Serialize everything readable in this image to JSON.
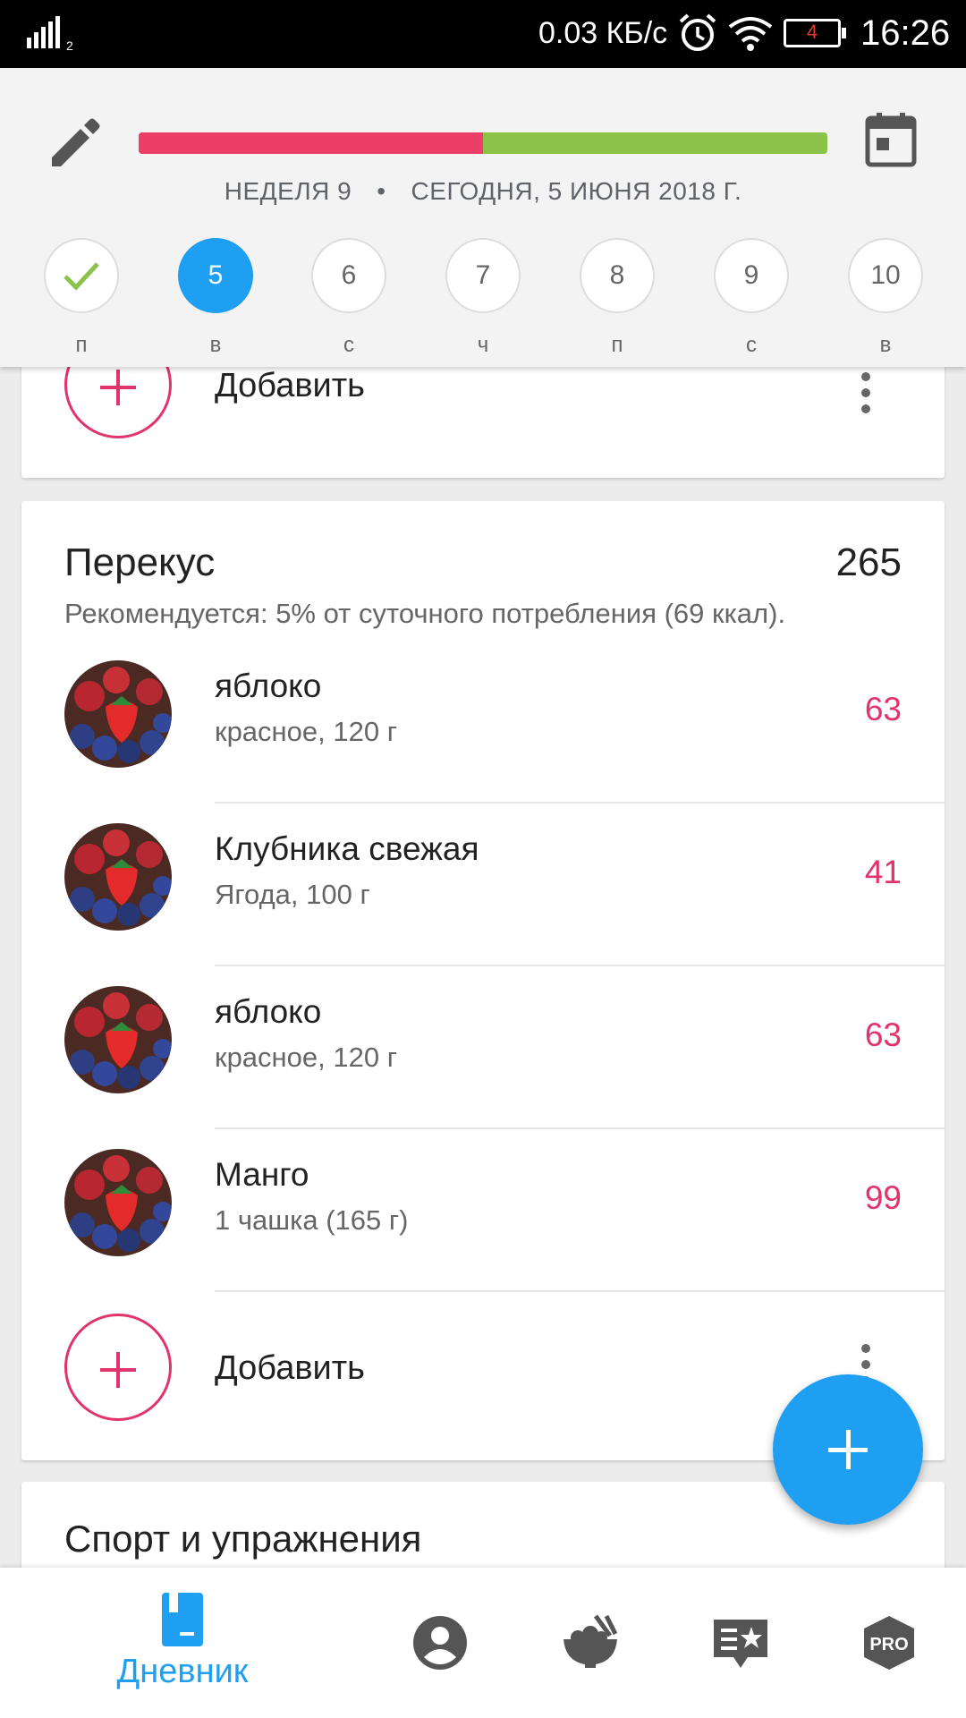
{
  "status_bar": {
    "signal_sub": "2",
    "net_speed": "0.03 КБ/с",
    "battery_level": "4",
    "time": "16:26"
  },
  "header": {
    "progress_fraction": 0.5,
    "colors": {
      "progress_fill": "#ec3e68",
      "progress_rest": "#8bc34a",
      "accent": "#1e9ff2"
    },
    "week_label": "НЕДЕЛЯ 9",
    "separator": "•",
    "date_label": "СЕГОДНЯ, 5 ИЮНЯ 2018 Г.",
    "days": [
      {
        "number": "",
        "letter": "п",
        "state": "done"
      },
      {
        "number": "5",
        "letter": "в",
        "state": "active"
      },
      {
        "number": "6",
        "letter": "с",
        "state": "normal"
      },
      {
        "number": "7",
        "letter": "ч",
        "state": "normal"
      },
      {
        "number": "8",
        "letter": "п",
        "state": "normal"
      },
      {
        "number": "9",
        "letter": "с",
        "state": "normal"
      },
      {
        "number": "10",
        "letter": "в",
        "state": "normal"
      }
    ]
  },
  "meal_top": {
    "add_label": "Добавить"
  },
  "snack": {
    "title": "Перекус",
    "total": "265",
    "recommendation": "Рекомендуется: 5% от суточного потребления (69 ккал).",
    "items": [
      {
        "name": "яблоко",
        "desc": "красное, 120 г",
        "kcal": "63"
      },
      {
        "name": "Клубника свежая",
        "desc": "Ягода, 100 г",
        "kcal": "41"
      },
      {
        "name": "яблоко",
        "desc": "красное, 120 г",
        "kcal": "63"
      },
      {
        "name": "Манго",
        "desc": "1 чашка (165 г)",
        "kcal": "99"
      }
    ],
    "add_label": "Добавить"
  },
  "sport": {
    "title": "Спорт и упражнения"
  },
  "bottom_nav": {
    "diary_label": "Дневник",
    "pro_label": "PRO",
    "icons": [
      "diary-icon",
      "profile-icon",
      "recipes-icon",
      "tips-icon",
      "pro-icon"
    ]
  }
}
